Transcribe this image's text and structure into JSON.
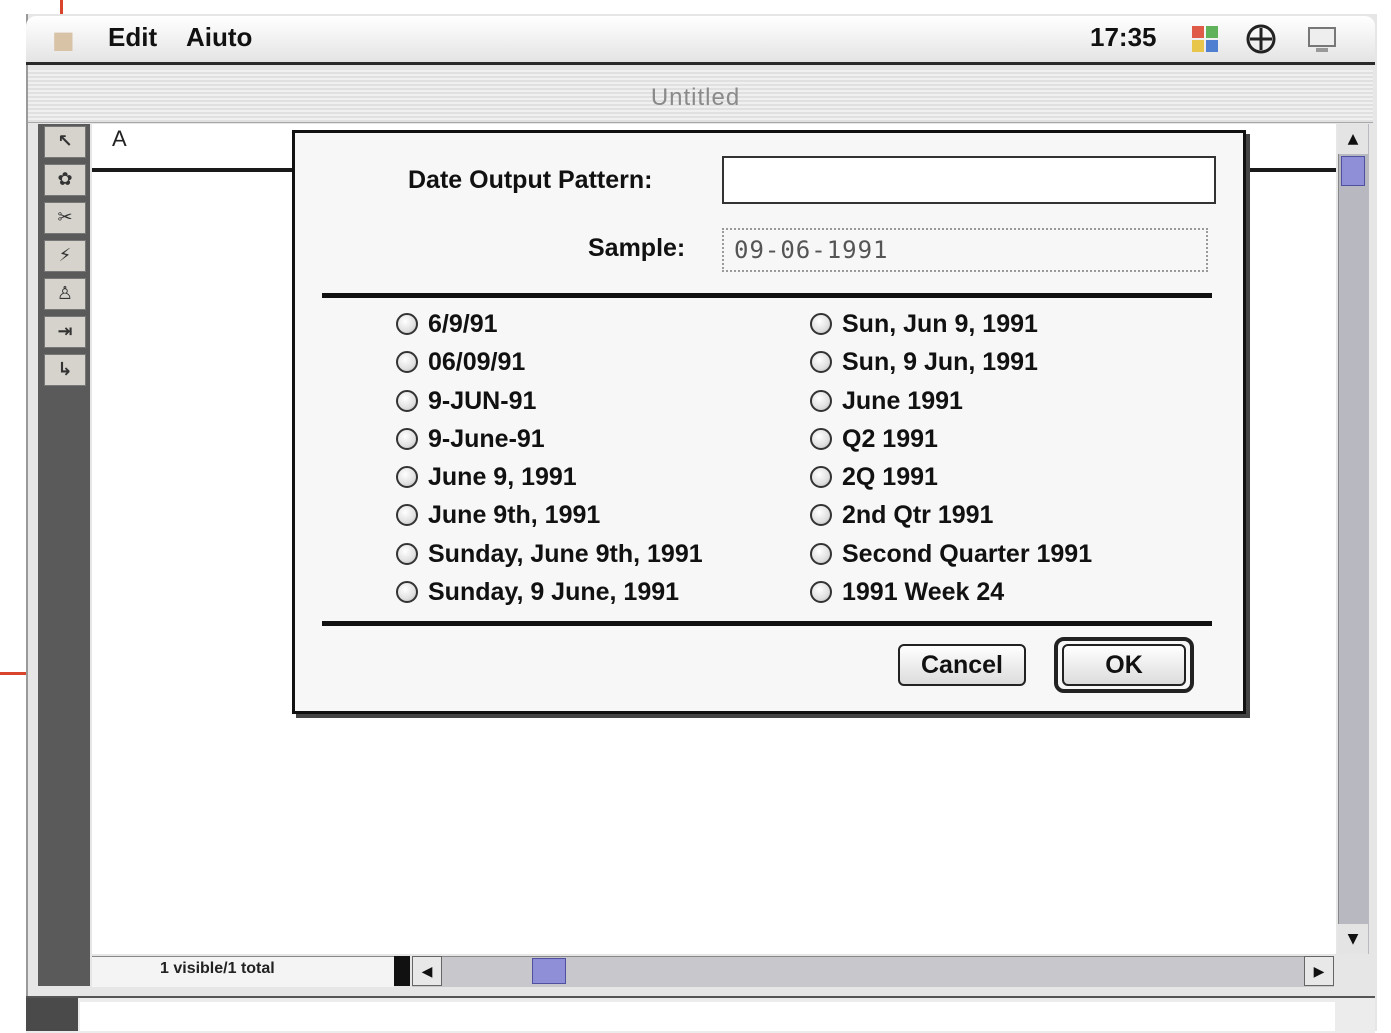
{
  "menubar": {
    "menus": [
      "Edit",
      "Aiuto"
    ],
    "clock": "17:35"
  },
  "window": {
    "title": "Untitled",
    "column_label": "A",
    "status": "1 visible/1 total"
  },
  "dialog": {
    "pattern_label": "Date Output Pattern:",
    "pattern_value": "",
    "sample_label": "Sample:",
    "sample_value": "09-06-1991",
    "left_options": [
      "6/9/91",
      "06/09/91",
      "9-JUN-91",
      "9-June-91",
      "June 9, 1991",
      "June 9th, 1991",
      "Sunday, June 9th, 1991",
      "Sunday, 9 June, 1991"
    ],
    "right_options": [
      "Sun, Jun 9, 1991",
      "Sun, 9 Jun, 1991",
      "June 1991",
      "Q2 1991",
      "2Q 1991",
      "2nd Qtr 1991",
      "Second Quarter 1991",
      "1991 Week 24"
    ],
    "cancel_label": "Cancel",
    "ok_label": "OK"
  },
  "icons": {
    "tools": [
      "pointer-tool-icon",
      "graphic-tool-icon",
      "cut-tool-icon",
      "formula-tool-icon",
      "lock-tool-icon",
      "move-right-tool-icon",
      "return-tool-icon"
    ],
    "tool_glyphs": [
      "↖",
      "✿",
      "✂",
      "⚡",
      "♙",
      "⇥",
      "↳"
    ],
    "menubar": [
      "application-menu-icon",
      "control-strip-icon",
      "monitor-icon"
    ]
  },
  "colors": {
    "accent": "#d8452c",
    "scroll_thumb": "#8f8fd8",
    "palette_bg": "#5a5a5a"
  }
}
